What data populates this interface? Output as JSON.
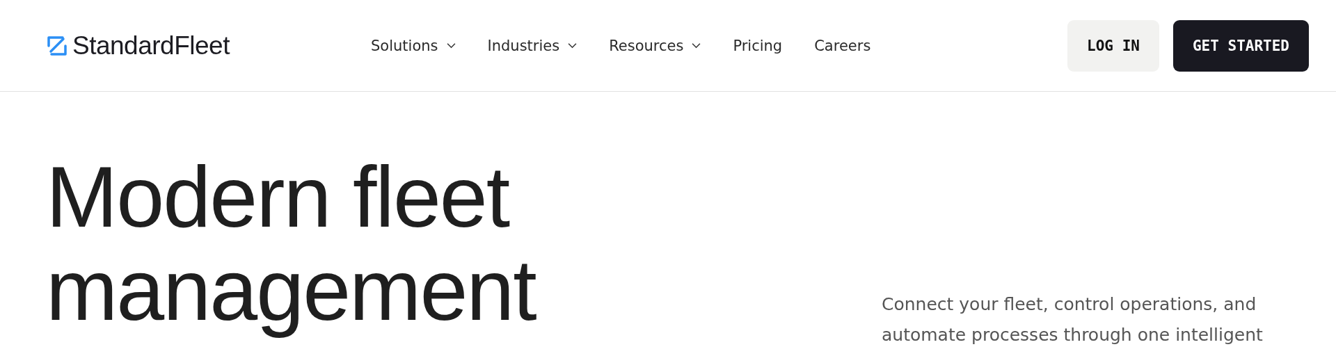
{
  "header": {
    "brand": "StandardFleet",
    "nav": [
      {
        "label": "Solutions",
        "has_menu": true
      },
      {
        "label": "Industries",
        "has_menu": true
      },
      {
        "label": "Resources",
        "has_menu": true
      },
      {
        "label": "Pricing",
        "has_menu": false
      },
      {
        "label": "Careers",
        "has_menu": false
      }
    ],
    "buttons": [
      {
        "label": "LOG IN",
        "kind": "secondary"
      },
      {
        "label": "GET STARTED",
        "kind": "primary"
      }
    ]
  },
  "hero": {
    "heading_lines": [
      "Modern fleet",
      "management"
    ],
    "description": "Connect your fleet, control operations, and automate processes through one intelligent"
  }
}
